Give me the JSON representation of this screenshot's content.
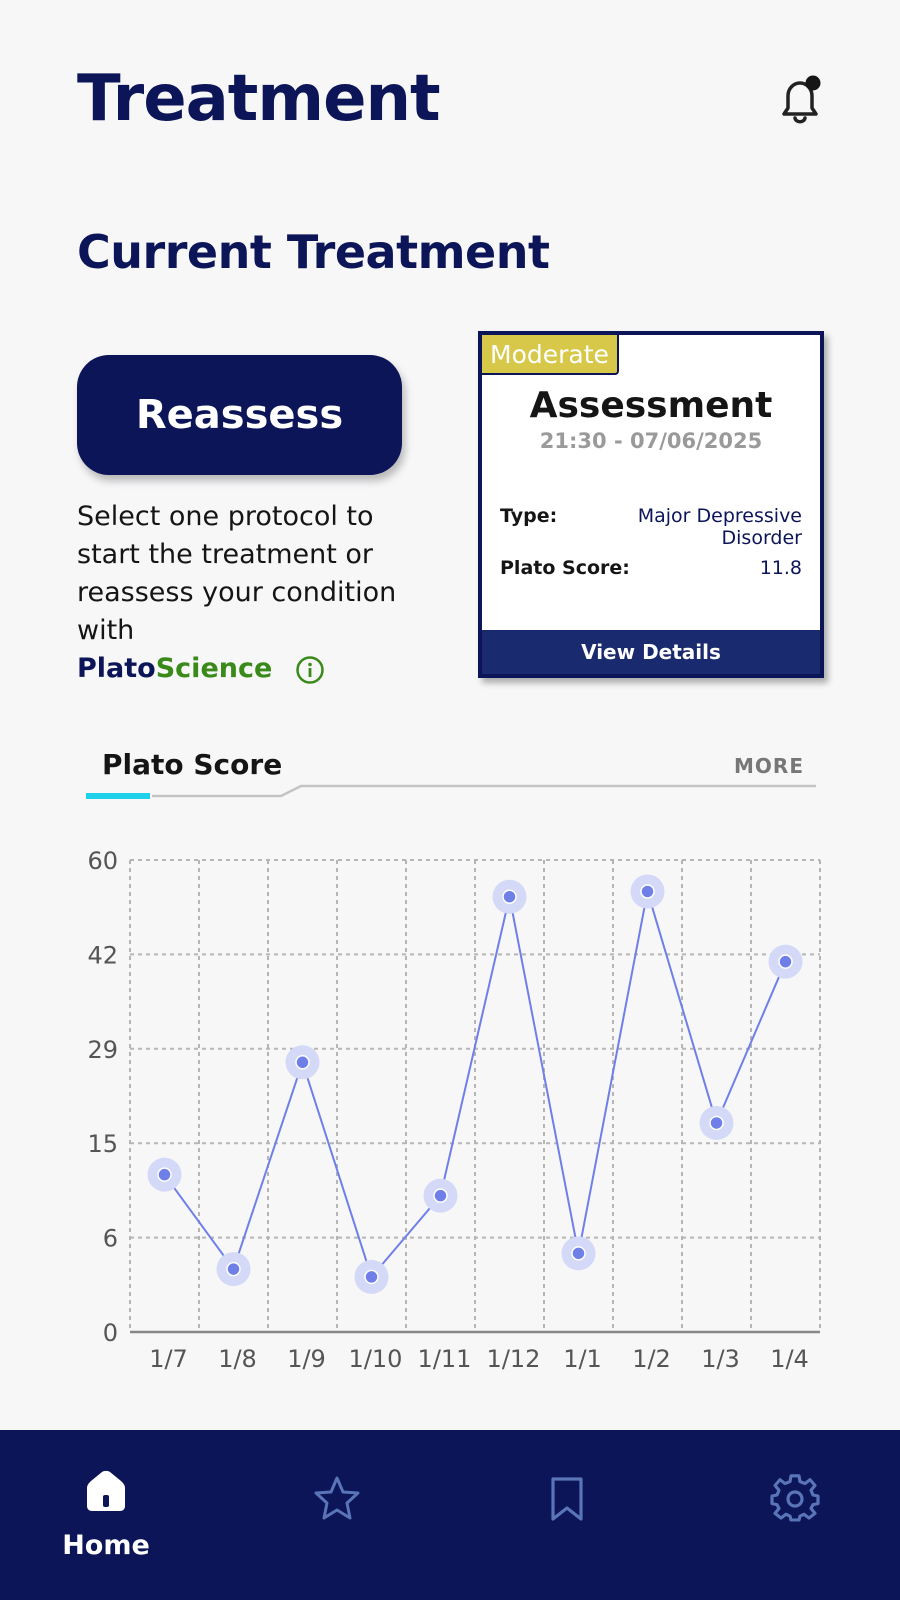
{
  "header": {
    "title": "Treatment",
    "notification_icon": "bell-icon",
    "notification_dot": true
  },
  "current": {
    "section_title": "Current Treatment",
    "reassess_label": "Reassess",
    "description": "Select one protocol to start the treatment or reassess your condition with",
    "brand_part1": "Plato",
    "brand_part2": "Science",
    "info_icon": "info-icon"
  },
  "assessment_card": {
    "badge": "Moderate",
    "title": "Assessment",
    "datetime": "21:30 - 07/06/2025",
    "type_label": "Type:",
    "type_value": "Major Depressive Disorder",
    "score_label": "Plato Score:",
    "score_value": "11.8",
    "footer_label": "View Details"
  },
  "chart_tabs": {
    "active_label": "Plato Score",
    "more_label": "MORE"
  },
  "chart_data": {
    "type": "line",
    "categories": [
      "1/7",
      "1/8",
      "1/9",
      "1/10",
      "1/11",
      "1/12",
      "1/1",
      "1/2",
      "1/3",
      "1/4"
    ],
    "values": [
      12,
      4,
      27,
      3.5,
      10,
      53,
      5,
      54,
      18,
      41
    ],
    "y_ticks": [
      0,
      6,
      15,
      29,
      42,
      60
    ],
    "ylim": [
      0,
      60
    ],
    "grid": true,
    "colors": {
      "line": "#6f7fe8",
      "halo": "#d3d9f7",
      "grid": "#b5b5b5"
    }
  },
  "bottom_nav": {
    "items": [
      {
        "label": "Home",
        "icon": "home-icon",
        "active": true
      },
      {
        "label": "",
        "icon": "star-icon",
        "active": false
      },
      {
        "label": "",
        "icon": "bookmark-icon",
        "active": false
      },
      {
        "label": "",
        "icon": "gear-icon",
        "active": false
      }
    ]
  }
}
